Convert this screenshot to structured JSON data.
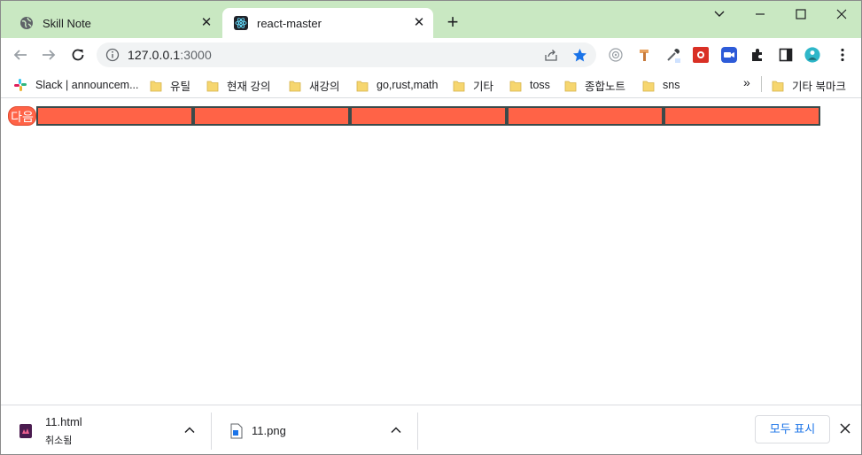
{
  "tabs": [
    {
      "title": "Skill Note",
      "favicon": "globe-icon",
      "close": "✕"
    },
    {
      "title": "react-master",
      "favicon": "react-icon",
      "close": "✕"
    }
  ],
  "new_tab": "+",
  "window_controls": {
    "dropdown": "⌄",
    "minimize": "—",
    "maximize": "☐",
    "close": "✕"
  },
  "toolbar": {
    "url_host": "127.0.0.1",
    "url_port": ":3000"
  },
  "bookmarks": [
    {
      "label": "Slack | announcem...",
      "icon": "slack-icon"
    },
    {
      "label": "유틸",
      "icon": "folder-icon"
    },
    {
      "label": "현재 강의",
      "icon": "folder-icon"
    },
    {
      "label": "새강의",
      "icon": "folder-icon"
    },
    {
      "label": "go,rust,math",
      "icon": "folder-icon"
    },
    {
      "label": "기타",
      "icon": "folder-icon"
    },
    {
      "label": "toss",
      "icon": "folder-icon"
    },
    {
      "label": "종합노트",
      "icon": "folder-icon"
    },
    {
      "label": "sns",
      "icon": "folder-icon"
    }
  ],
  "bookmarks_more": "»",
  "other_bookmarks": "기타 북마크",
  "page": {
    "next_button": "다음",
    "bar_count": 5,
    "colors": {
      "bar_fill": "#ff6347",
      "bar_border": "#3b4a4a"
    }
  },
  "downloads": [
    {
      "name": "11.html",
      "status": "취소됨"
    },
    {
      "name": "11.png",
      "status": ""
    }
  ],
  "show_all": "모두 표시",
  "shelf_close": "✕"
}
